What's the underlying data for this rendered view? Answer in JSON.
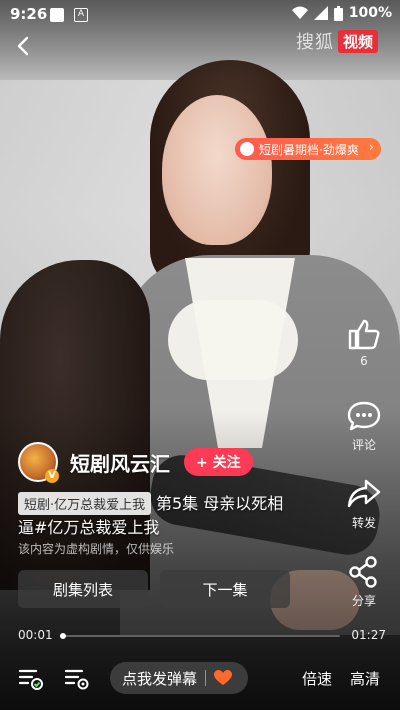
{
  "status_bar": {
    "time": "9:26",
    "battery": "100%"
  },
  "brand": {
    "text": "搜狐",
    "box": "视频"
  },
  "promo_badge": {
    "label": "短剧暑期档·劲爆爽"
  },
  "actions": [
    {
      "name": "like",
      "icon": "thumbs-up-icon",
      "label": "6"
    },
    {
      "name": "comment",
      "icon": "comment-icon",
      "label": "评论"
    },
    {
      "name": "share-forward",
      "icon": "share-forward-icon",
      "label": "转发"
    },
    {
      "name": "share",
      "icon": "share-icon",
      "label": "分享"
    }
  ],
  "creator": {
    "name": "短剧风云汇",
    "badge": "V",
    "follow_label": "+ 关注"
  },
  "video": {
    "tag": "短剧·亿万总裁爱上我",
    "title_line1": "第5集 母亲以死相",
    "title_line2": "逼#亿万总裁爱上我",
    "disclaimer": "该内容为虚构剧情，仅供娱乐"
  },
  "buttons": {
    "episode_list": "剧集列表",
    "next_episode": "下一集"
  },
  "playback": {
    "current": "00:01",
    "duration": "01:27",
    "progress": 0.01
  },
  "bottom_bar": {
    "danmu_placeholder": "点我发弹幕",
    "speed": "倍速",
    "quality": "高清"
  },
  "colors": {
    "accent": "#ff3a55",
    "brand_red": "#e8303b",
    "promo": "#ff6a44"
  }
}
